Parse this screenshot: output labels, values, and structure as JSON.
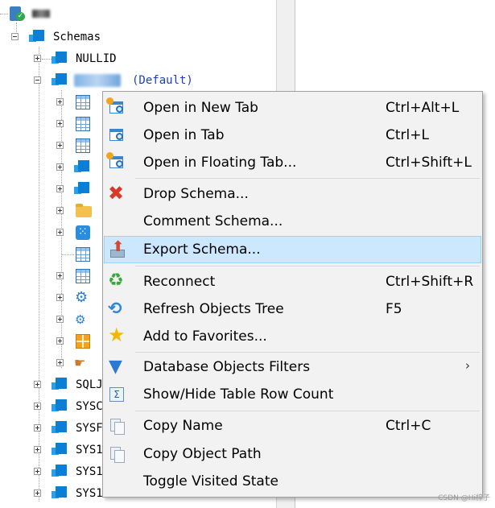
{
  "tree": {
    "schemas_label": "Schemas",
    "nullid_label": "NULLID",
    "default_tag": "(Default)",
    "partial_rows": [
      {
        "name": "sqlj",
        "label": "SQLJ"
      },
      {
        "name": "sysc",
        "label": "SYSC"
      },
      {
        "name": "sysf",
        "label": "SYSF"
      },
      {
        "name": "sys1",
        "label": "SYS1"
      },
      {
        "name": "sys2",
        "label": "SYS1"
      },
      {
        "name": "sys3",
        "label": "SYS1"
      }
    ]
  },
  "context_menu": {
    "items": [
      {
        "label": "Open in New Tab",
        "shortcut": "Ctrl+Alt+L",
        "icon": "open-new-tab-icon"
      },
      {
        "label": "Open in Tab",
        "shortcut": "Ctrl+L",
        "icon": "open-tab-icon"
      },
      {
        "label": "Open in Floating Tab...",
        "shortcut": "Ctrl+Shift+L",
        "icon": "open-floating-tab-icon"
      },
      {
        "label": "Drop Schema...",
        "shortcut": "",
        "icon": "red-x-icon"
      },
      {
        "label": "Comment Schema...",
        "shortcut": "",
        "icon": ""
      },
      {
        "label": "Export Schema...",
        "shortcut": "",
        "icon": "export-icon"
      },
      {
        "label": "Reconnect",
        "shortcut": "Ctrl+Shift+R",
        "icon": "reconnect-icon"
      },
      {
        "label": "Refresh Objects Tree",
        "shortcut": "F5",
        "icon": "refresh-icon"
      },
      {
        "label": "Add to Favorites...",
        "shortcut": "",
        "icon": "star-icon"
      },
      {
        "label": "Database Objects Filters",
        "shortcut": "",
        "icon": "filter-icon"
      },
      {
        "label": "Show/Hide Table Row Count",
        "shortcut": "",
        "icon": "row-count-icon"
      },
      {
        "label": "Copy Name",
        "shortcut": "Ctrl+C",
        "icon": "copy-icon"
      },
      {
        "label": "Copy Object Path",
        "shortcut": "",
        "icon": "copy-path-icon"
      },
      {
        "label": "Toggle Visited State",
        "shortcut": "",
        "icon": ""
      }
    ],
    "highlighted_item": "Export Schema...",
    "highlight_color": "#cce8ff"
  },
  "watermark": "CSDN @Hi梓子"
}
